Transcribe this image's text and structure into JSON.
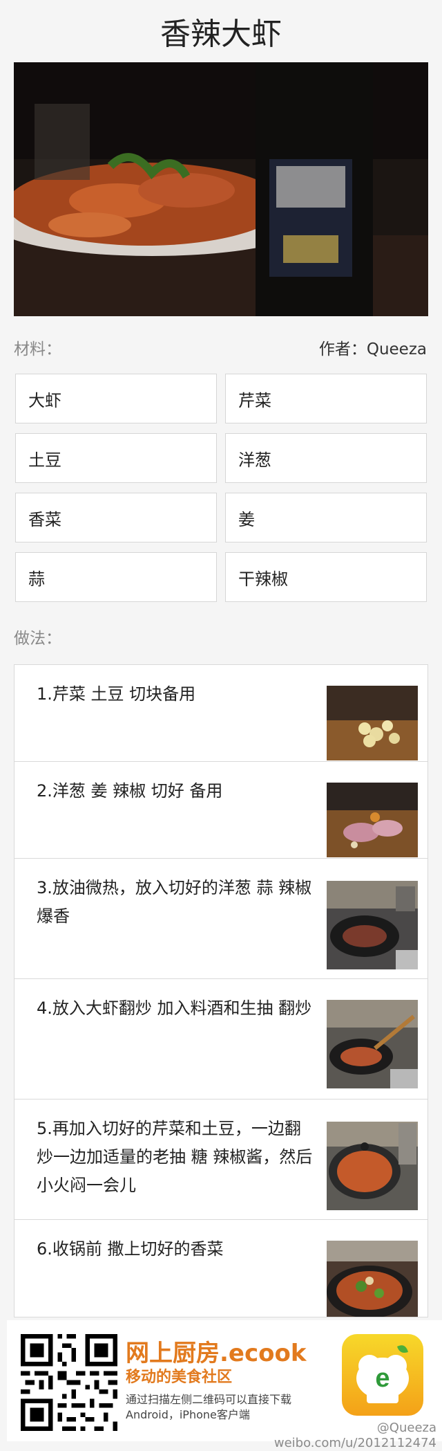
{
  "recipe": {
    "title": "香辣大虾",
    "materials_label": "材料：",
    "author_label": "作者：Queeza",
    "method_label": "做法：",
    "ingredients": [
      "大虾",
      "芹菜",
      "土豆",
      "洋葱",
      "香菜",
      "姜",
      "蒜",
      "干辣椒"
    ],
    "steps": [
      {
        "text": "1.芹菜 土豆 切块备用"
      },
      {
        "text": "2.洋葱 姜 辣椒 切好 备用"
      },
      {
        "text": "3.放油微热，放入切好的洋葱 蒜 辣椒 爆香"
      },
      {
        "text": "4.放入大虾翻炒 加入料酒和生抽 翻炒"
      },
      {
        "text": "5.再加入切好的芹菜和土豆，一边翻炒一边加适量的老抽 糖 辣椒酱，然后小火闷一会儿"
      },
      {
        "text": "6.收锅前 撒上切好的香菜"
      }
    ]
  },
  "footer": {
    "brand": "网上厨房.ecook",
    "tagline": "移动的美食社区",
    "hint": "通过扫描左侧二维码可以直接下载Android，iPhone客户端",
    "app_icon_letter": "e"
  },
  "watermark": {
    "handle": "@Queeza",
    "url": "weibo.com/u/2012112474"
  },
  "colors": {
    "brand_orange": "#e27a1e",
    "background": "#f5f5f5"
  }
}
